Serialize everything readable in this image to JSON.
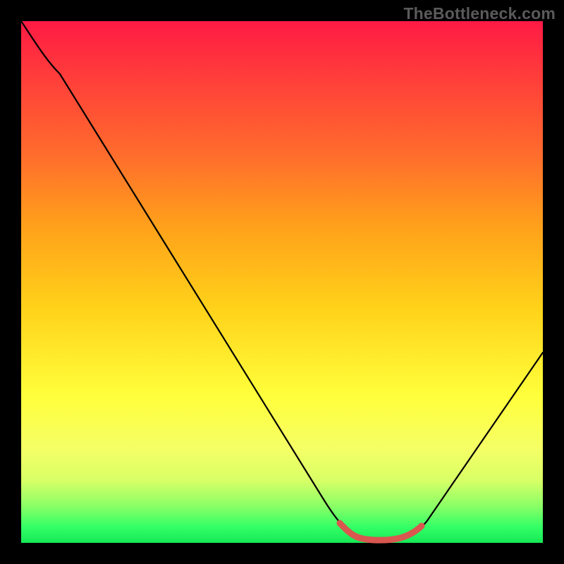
{
  "watermark": "TheBottleneck.com",
  "chart_data": {
    "type": "line",
    "title": "",
    "xlabel": "",
    "ylabel": "",
    "xlim": [
      0,
      100
    ],
    "ylim": [
      0,
      100
    ],
    "grid": false,
    "series": [
      {
        "name": "bottleneck-curve",
        "x": [
          0,
          5,
          10,
          20,
          30,
          40,
          50,
          58,
          63,
          68,
          73,
          78,
          85,
          92,
          100
        ],
        "values": [
          100,
          96,
          91,
          78,
          65,
          52,
          38,
          22,
          8,
          2,
          1,
          2,
          8,
          20,
          37
        ]
      },
      {
        "name": "optimal-range-highlight",
        "x": [
          63,
          68,
          73,
          78
        ],
        "values": [
          3.5,
          1.8,
          1.5,
          3.2
        ]
      }
    ],
    "colors": {
      "curve": "#000000",
      "highlight": "#d9574f",
      "background_gradient": [
        "#ff1a44",
        "#ffa31a",
        "#ffff3b",
        "#15e956"
      ]
    }
  }
}
